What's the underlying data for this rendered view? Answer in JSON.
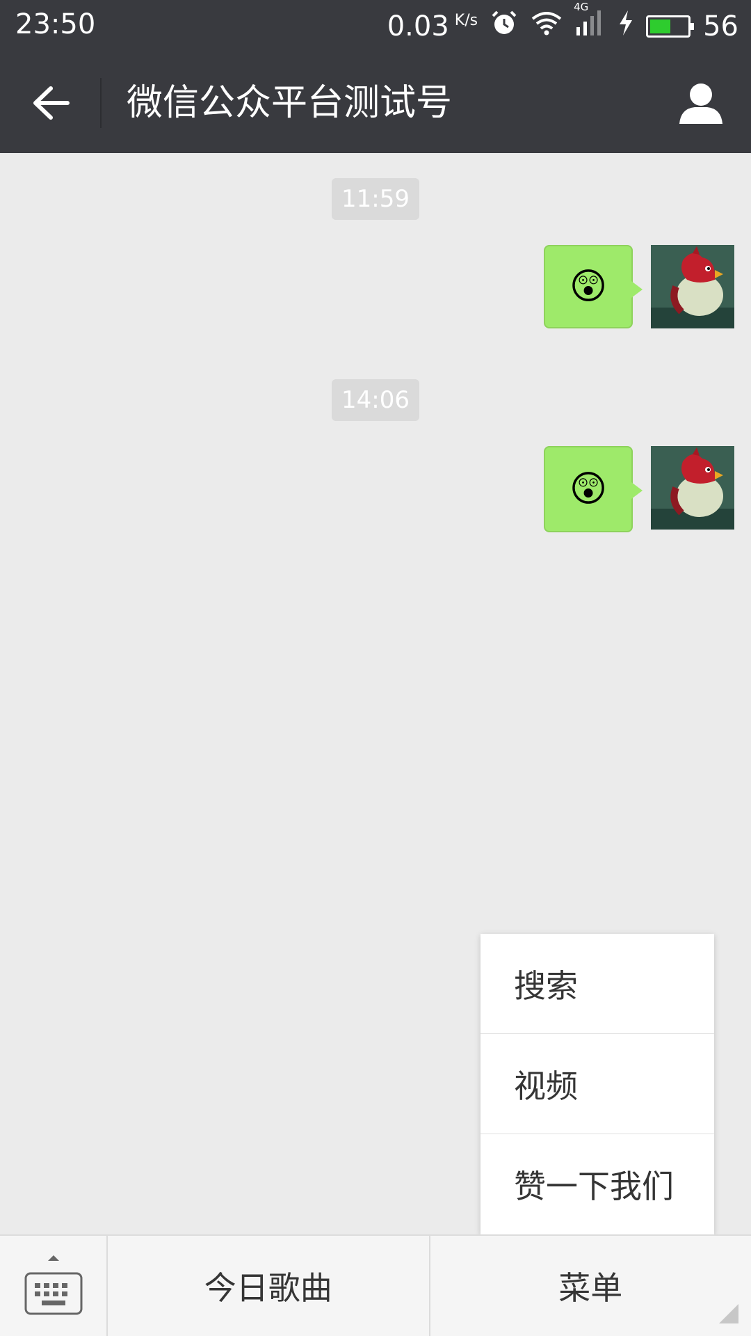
{
  "status_bar": {
    "time": "23:50",
    "net_speed": "0.03",
    "net_unit": "K/s",
    "network_type": "4G",
    "battery_level": "56",
    "icons": [
      "alarm-icon",
      "wifi-icon",
      "signal-icon",
      "charging-icon",
      "battery-icon"
    ]
  },
  "nav": {
    "title": "微信公众平台测试号",
    "back_icon": "back-arrow-icon",
    "profile_icon": "person-icon"
  },
  "chat": {
    "messages": [
      {
        "timestamp": "11:59",
        "content": "😲",
        "sender": "self"
      },
      {
        "timestamp": "14:06",
        "content": "😲",
        "sender": "self"
      }
    ]
  },
  "popup_menu": {
    "items": [
      "搜索",
      "视频",
      "赞一下我们"
    ]
  },
  "bottom_bar": {
    "keyboard_icon": "keyboard-icon",
    "tabs": [
      "今日歌曲",
      "菜单"
    ]
  },
  "colors": {
    "header": "#393a3f",
    "bubble": "#9eea6a",
    "background": "#ebebeb"
  }
}
